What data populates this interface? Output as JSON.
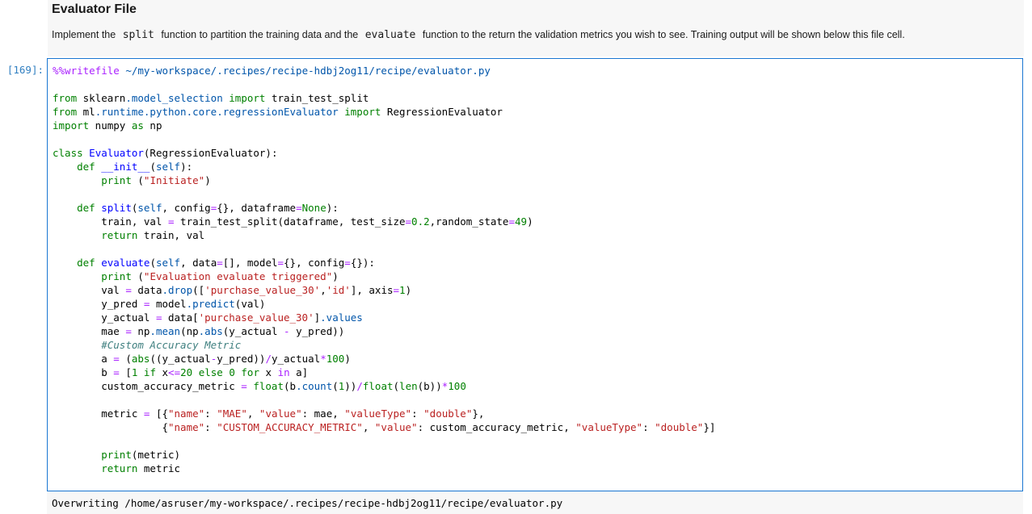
{
  "markdown": {
    "title": "Evaluator File",
    "text_before_split": "Implement the",
    "split_code": "split",
    "text_between": "function to partition the training data and the",
    "evaluate_code": "evaluate",
    "text_after": "function to the return the validation metrics you wish to see. Training output will be shown below this file cell."
  },
  "cell": {
    "prompt": "[169]:",
    "magic": "%%writefile",
    "path": "~/my-workspace/.recipes/recipe-hdbj2og11/recipe/evaluator.py"
  },
  "output": {
    "text": "Overwriting /home/asruser/my-workspace/.recipes/recipe-hdbj2og11/recipe/evaluator.py"
  },
  "colors": {
    "cell_border": "#1976d2",
    "prompt": "#307fc1",
    "markdown_bg": "#f7f7f7"
  }
}
